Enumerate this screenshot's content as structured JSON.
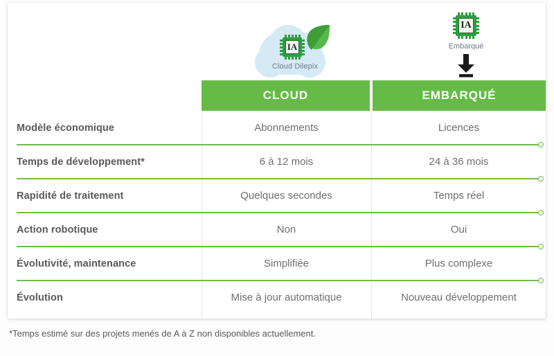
{
  "illustrations": {
    "cloud": {
      "chip_label": "IA",
      "caption": "Cloud Dilepix",
      "icons": {
        "chip": "cpu-chip-icon",
        "leaf": "leaf-icon",
        "cloud": "cloud-icon"
      }
    },
    "embarque": {
      "chip_label": "IA",
      "caption": "Embarqué",
      "icons": {
        "chip": "cpu-chip-icon",
        "arrow": "download-arrow-icon"
      }
    }
  },
  "table": {
    "columns": [
      {
        "key": "cloud",
        "label": "CLOUD"
      },
      {
        "key": "embarque",
        "label": "EMBARQUÉ"
      }
    ],
    "rows": [
      {
        "label": "Modèle économique",
        "cloud": "Abonnements",
        "embarque": "Licences"
      },
      {
        "label": "Temps de développement*",
        "cloud": "6 à 12 mois",
        "embarque": "24 à 36 mois"
      },
      {
        "label": "Rapidité de traitement",
        "cloud": "Quelques secondes",
        "embarque": "Temps réel"
      },
      {
        "label": "Action robotique",
        "cloud": "Non",
        "embarque": "Oui"
      },
      {
        "label": "Évolutivité, maintenance",
        "cloud": "Simplifiée",
        "embarque": "Plus complexe"
      },
      {
        "label": "Évolution",
        "cloud": "Mise à jour automatique",
        "embarque": "Nouveau développement"
      }
    ]
  },
  "footnote": "*Temps estimé sur des projets menés de A à Z non disponibles actuellement.",
  "colors": {
    "header_green": "#66bb47",
    "separator_green": "#6fba4b",
    "chip_green": "#2f9e3e",
    "cloud_blue": "#d6eaf6",
    "text_dark": "#58595b",
    "text_body": "#6d6e71",
    "caption_gray": "#6f7b86"
  }
}
